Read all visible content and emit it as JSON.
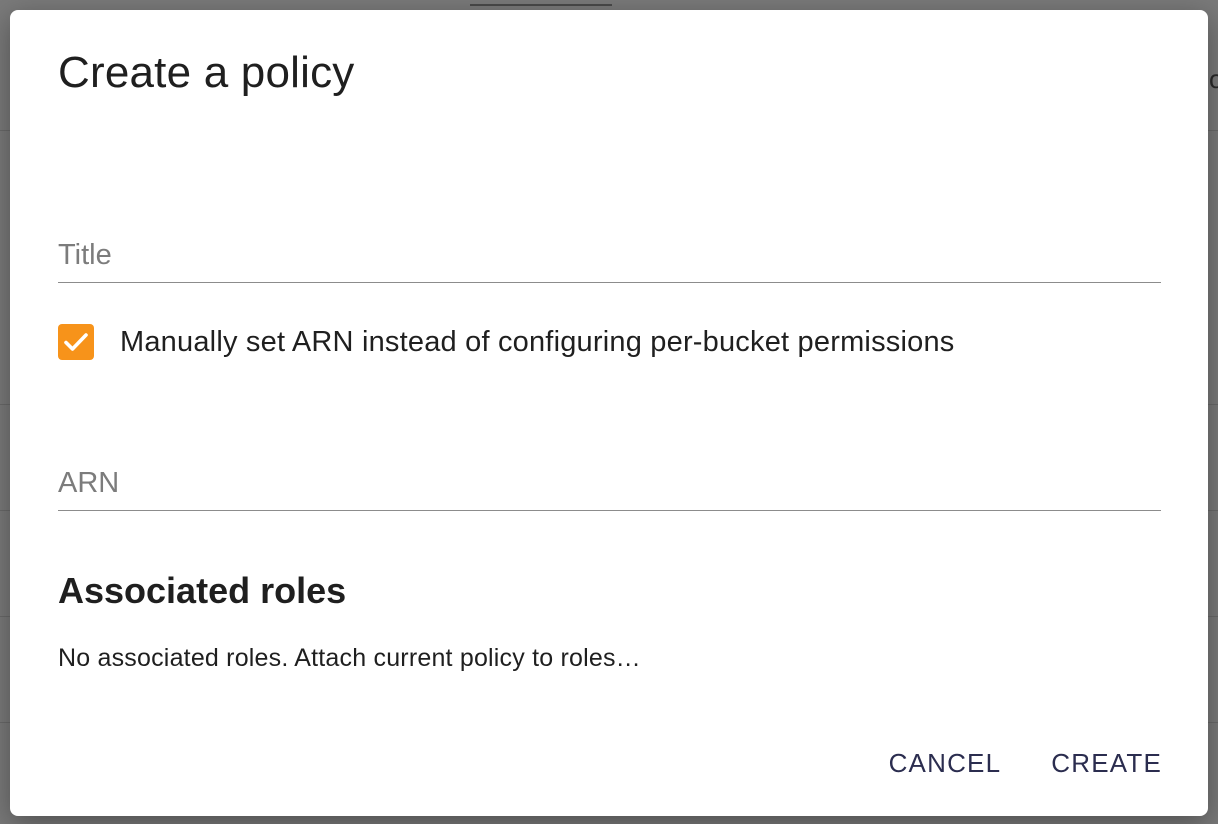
{
  "dialog": {
    "title": "Create a policy",
    "title_field": {
      "placeholder": "Title",
      "value": ""
    },
    "arn_checkbox": {
      "checked": true,
      "label": "Manually set ARN instead of configuring per-bucket permissions"
    },
    "arn_field": {
      "placeholder": "ARN",
      "value": ""
    },
    "roles_section": {
      "heading": "Associated roles",
      "text": "No associated roles. Attach current policy to roles…"
    },
    "actions": {
      "cancel_label": "CANCEL",
      "create_label": "CREATE"
    }
  },
  "colors": {
    "accent_checkbox": "#f7931a",
    "button_text": "#2b2d4f",
    "overlay": "#7a7a7a"
  },
  "icons": {
    "checkbox": "checkmark-icon"
  }
}
